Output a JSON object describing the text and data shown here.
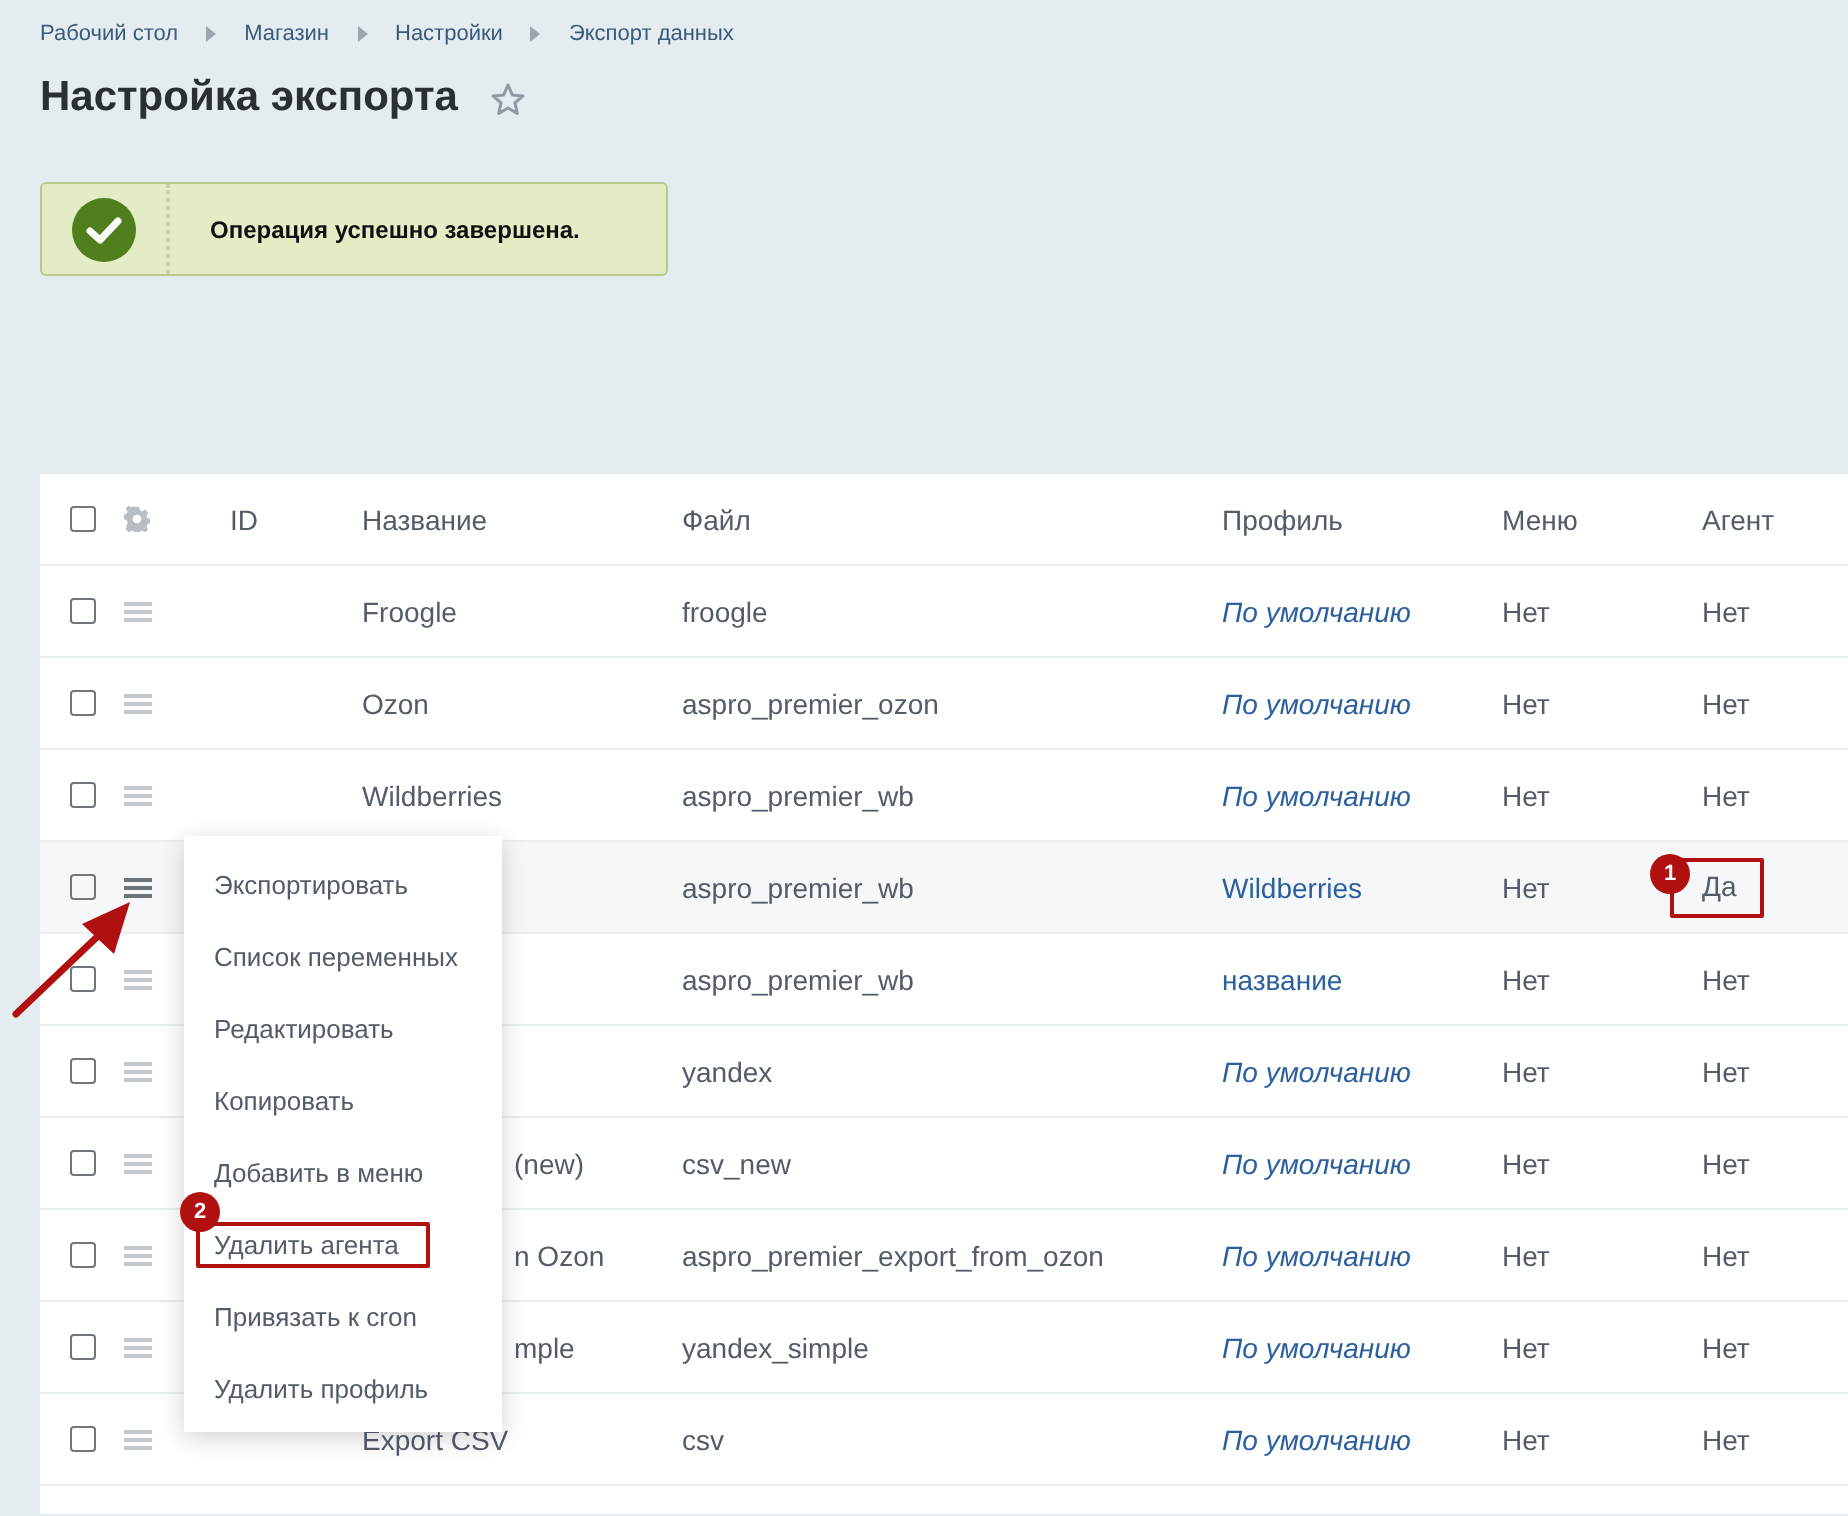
{
  "breadcrumbs": [
    "Рабочий стол",
    "Магазин",
    "Настройки",
    "Экспорт данных"
  ],
  "title": "Настройка экспорта",
  "favorite": false,
  "notice": {
    "kind": "success",
    "text": "Операция успешно завершена."
  },
  "table": {
    "select_all_checked": false,
    "columns": [
      "ID",
      "Название",
      "Файл",
      "Профиль",
      "Меню",
      "Агент"
    ],
    "rows": [
      {
        "checked": false,
        "highlighted": false,
        "name": "Froogle",
        "file": "froogle",
        "profile": "По умолчанию",
        "profile_default": true,
        "menu": "Нет",
        "agent": "Нет"
      },
      {
        "checked": false,
        "highlighted": false,
        "name": "Ozon",
        "file": "aspro_premier_ozon",
        "profile": "По умолчанию",
        "profile_default": true,
        "menu": "Нет",
        "agent": "Нет"
      },
      {
        "checked": false,
        "highlighted": false,
        "name": "Wildberries",
        "file": "aspro_premier_wb",
        "profile": "По умолчанию",
        "profile_default": true,
        "menu": "Нет",
        "agent": "Нет"
      },
      {
        "checked": false,
        "highlighted": true,
        "file": "aspro_premier_wb",
        "profile": "Wildberries",
        "profile_default": false,
        "menu": "Нет",
        "agent": "Да",
        "agent_marker": "1"
      },
      {
        "checked": false,
        "highlighted": false,
        "file": "aspro_premier_wb",
        "profile": "название",
        "profile_default": false,
        "menu": "Нет",
        "agent": "Нет"
      },
      {
        "checked": false,
        "highlighted": false,
        "file": "yandex",
        "profile": "По умолчанию",
        "profile_default": true,
        "menu": "Нет",
        "agent": "Нет"
      },
      {
        "checked": false,
        "highlighted": false,
        "name": "(new)",
        "name_clipped": true,
        "file": "csv_new",
        "profile": "По умолчанию",
        "profile_default": true,
        "menu": "Нет",
        "agent": "Нет"
      },
      {
        "checked": false,
        "highlighted": false,
        "name": "n Ozon",
        "name_clipped": true,
        "file": "aspro_premier_export_from_ozon",
        "profile": "По умолчанию",
        "profile_default": true,
        "menu": "Нет",
        "agent": "Нет"
      },
      {
        "checked": false,
        "highlighted": false,
        "name": "mple",
        "name_clipped": true,
        "file": "yandex_simple",
        "profile": "По умолчанию",
        "profile_default": true,
        "menu": "Нет",
        "agent": "Нет"
      },
      {
        "checked": false,
        "highlighted": false,
        "name": "Export CSV",
        "file": "csv",
        "profile": "По умолчанию",
        "profile_default": true,
        "menu": "Нет",
        "agent": "Нет"
      }
    ]
  },
  "context_menu": {
    "items": [
      {
        "label": "Экспортировать"
      },
      {
        "label": "Список переменных"
      },
      {
        "label": "Редактировать"
      },
      {
        "label": "Копировать"
      },
      {
        "label": "Добавить в меню"
      },
      {
        "label": "Удалить агента",
        "marker": "2"
      },
      {
        "label": "Привязать к cron"
      },
      {
        "label": "Удалить профиль"
      }
    ]
  }
}
